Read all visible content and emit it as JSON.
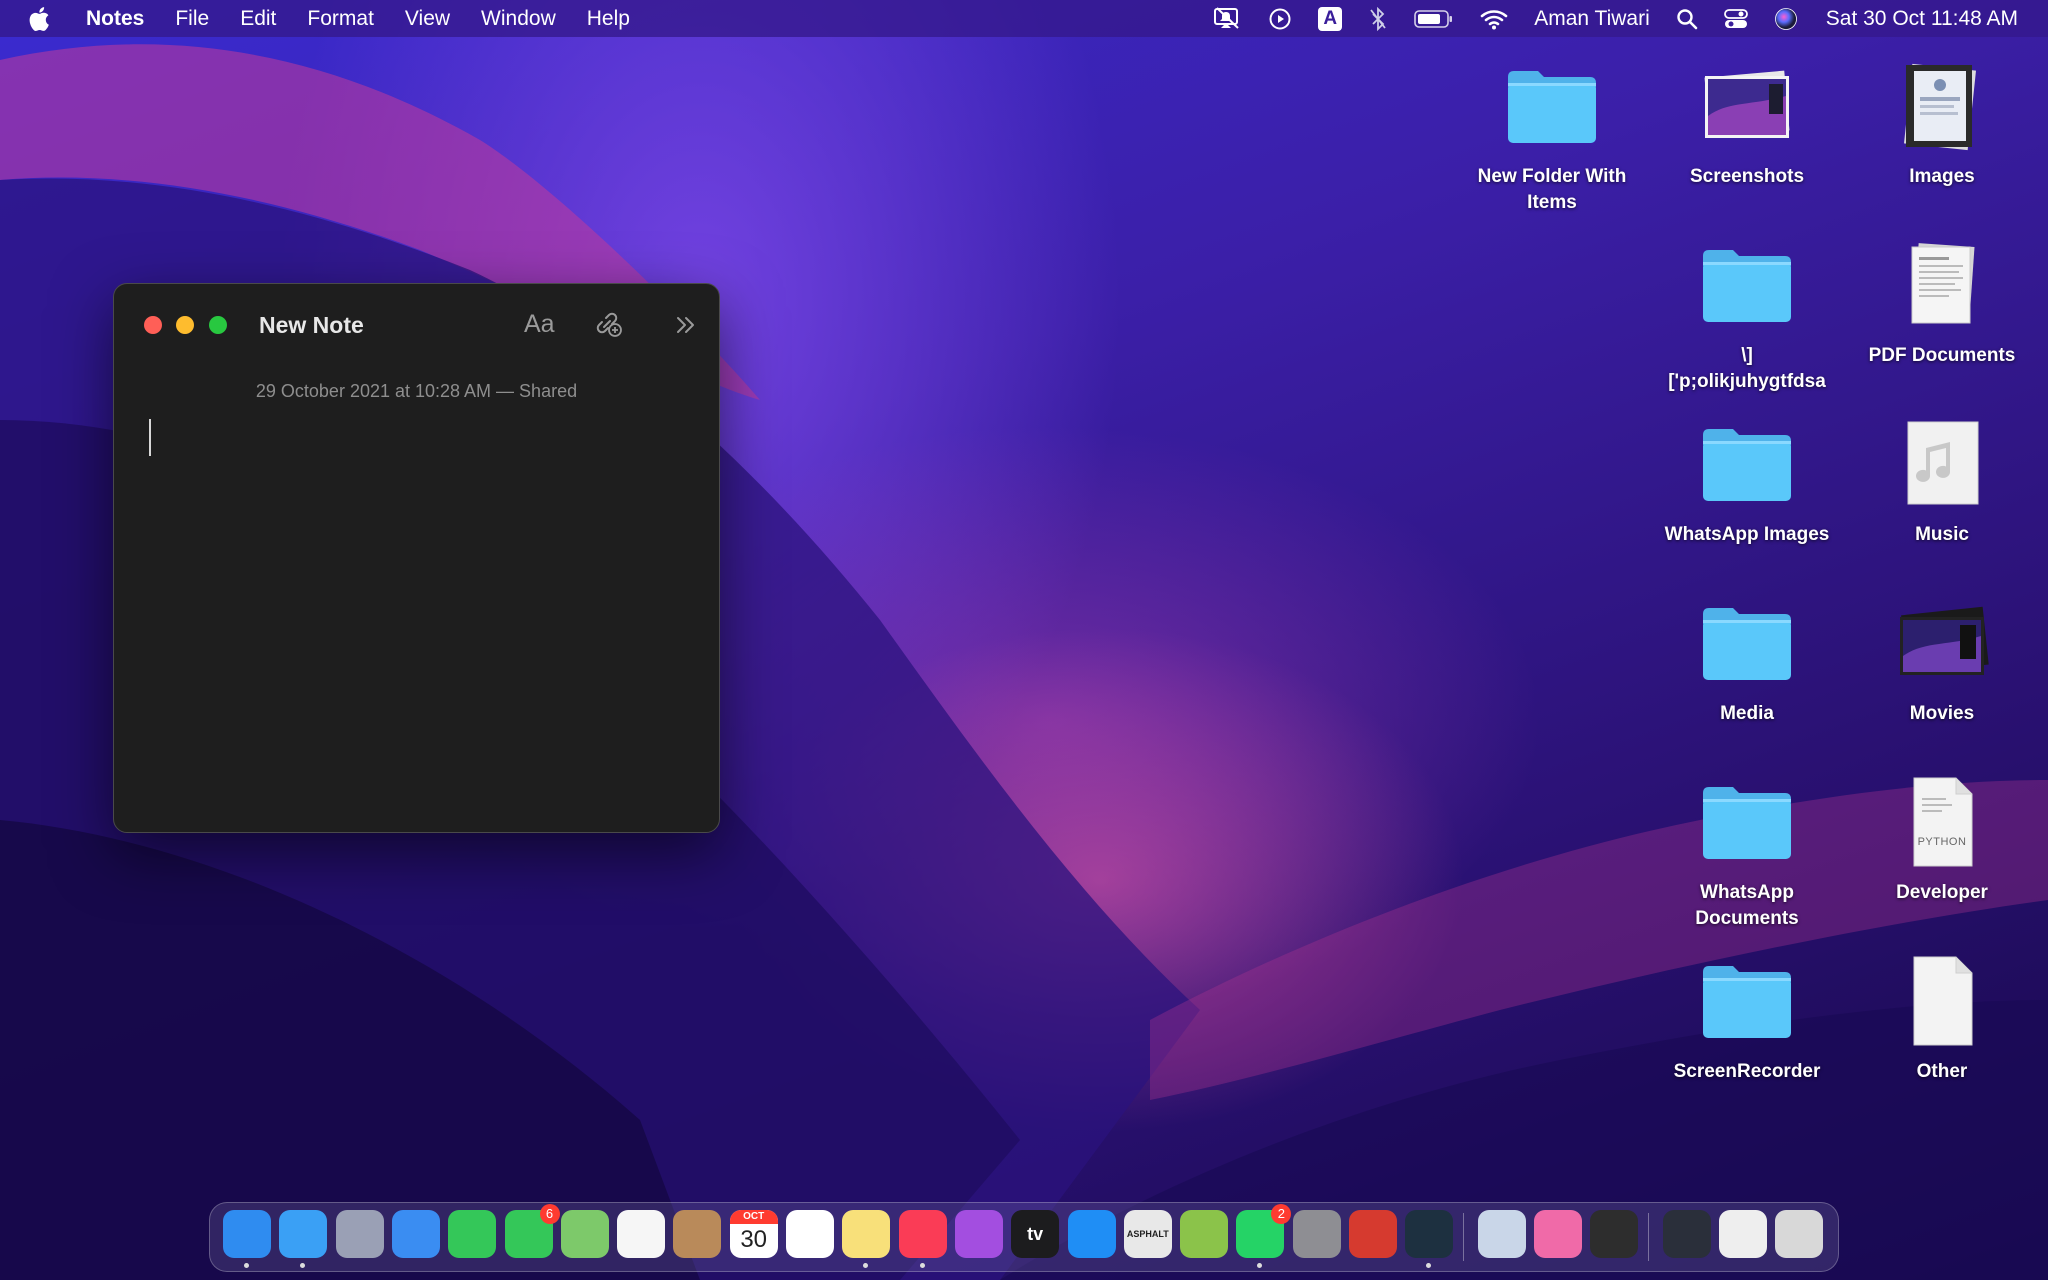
{
  "menubar": {
    "app_name": "Notes",
    "menus": [
      "File",
      "Edit",
      "Format",
      "View",
      "Window",
      "Help"
    ],
    "status_icons": [
      "notifications-off-icon",
      "play-circle-icon",
      "input-source-icon",
      "bluetooth-off-icon",
      "battery-icon",
      "wifi-icon"
    ],
    "input_source_letter": "A",
    "user_name": "Aman Tiwari",
    "date_time": "Sat 30 Oct  11:48 AM"
  },
  "note_window": {
    "title": "New Note",
    "font_button": "Aa",
    "date_line": "29 October 2021 at 10:28 AM — Shared",
    "body": ""
  },
  "desktop_items": [
    {
      "label": "New Folder With Items",
      "type": "folder"
    },
    {
      "label": "Screenshots",
      "type": "screenshot-stack"
    },
    {
      "label": "Images",
      "type": "image-stack"
    },
    {
      "label": "\\]\n['p;olikjuhygtfdsa",
      "type": "folder"
    },
    {
      "label": "PDF Documents",
      "type": "document-stack"
    },
    {
      "label": "WhatsApp Images",
      "type": "folder"
    },
    {
      "label": "Music",
      "type": "music-file"
    },
    {
      "label": "Media",
      "type": "folder"
    },
    {
      "label": "Movies",
      "type": "movie-stack"
    },
    {
      "label": "WhatsApp Documents",
      "type": "folder"
    },
    {
      "label": "Developer",
      "type": "python-file"
    },
    {
      "label": "ScreenRecorder",
      "type": "folder"
    },
    {
      "label": "Other",
      "type": "blank-file"
    }
  ],
  "python_file_tag": "PYTHON",
  "dock": {
    "apps": [
      {
        "name": "finder-icon",
        "color": "#2f8cf0",
        "running": true
      },
      {
        "name": "safari-icon",
        "color": "#3aa0f5",
        "running": true
      },
      {
        "name": "launchpad-icon",
        "color": "#9aa0b5",
        "running": false
      },
      {
        "name": "mail-icon",
        "color": "#3a8df2",
        "running": false
      },
      {
        "name": "facetime-icon",
        "color": "#34c759",
        "running": false
      },
      {
        "name": "messages-icon",
        "color": "#34c759",
        "running": false,
        "badge": "6"
      },
      {
        "name": "maps-icon",
        "color": "#7dc96a",
        "running": false
      },
      {
        "name": "photos-icon",
        "color": "#f6f6f6",
        "running": false
      },
      {
        "name": "contacts-icon",
        "color": "#b98a5a",
        "running": false
      },
      {
        "name": "calendar-icon",
        "color": "#ffffff",
        "running": false,
        "month": "OCT",
        "day": "30"
      },
      {
        "name": "reminders-icon",
        "color": "#ffffff",
        "running": false
      },
      {
        "name": "notes-icon",
        "color": "#f8e07a",
        "running": true
      },
      {
        "name": "music-icon",
        "color": "#fa3c56",
        "running": true
      },
      {
        "name": "podcasts-icon",
        "color": "#a34ee0",
        "running": false
      },
      {
        "name": "apple-tv-icon",
        "color": "#1c1c1e",
        "running": false,
        "label": "tv"
      },
      {
        "name": "app-store-icon",
        "color": "#1f8ef5",
        "running": false
      },
      {
        "name": "asphalt-icon",
        "color": "#e8e8e8",
        "running": false,
        "label": "ASPHALT"
      },
      {
        "name": "android-studio-icon",
        "color": "#8bc34a",
        "running": false
      },
      {
        "name": "whatsapp-icon",
        "color": "#25d366",
        "running": true,
        "badge": "2"
      },
      {
        "name": "system-preferences-icon",
        "color": "#8e8e93",
        "running": false
      },
      {
        "name": "remote-desktop-icon",
        "color": "#d63a2f",
        "running": false
      },
      {
        "name": "filmora-icon",
        "color": "#1d3040",
        "running": true
      }
    ],
    "recent_apps": [
      {
        "name": "preview-icon",
        "color": "#c9d6e8"
      },
      {
        "name": "cleanmymac-icon",
        "color": "#f06aa8"
      },
      {
        "name": "quicktime-icon",
        "color": "#2d2d2d"
      }
    ],
    "stacks": [
      {
        "name": "downloads-stack-icon",
        "color": "#2a2f3a"
      },
      {
        "name": "documents-stack-icon",
        "color": "#eeeeee"
      },
      {
        "name": "trash-icon",
        "color": "#d8d8d8"
      }
    ]
  },
  "colors": {
    "folder": "#5ac8fa",
    "close": "#ff5f57",
    "minimize": "#febc2e",
    "zoom": "#28c840"
  }
}
